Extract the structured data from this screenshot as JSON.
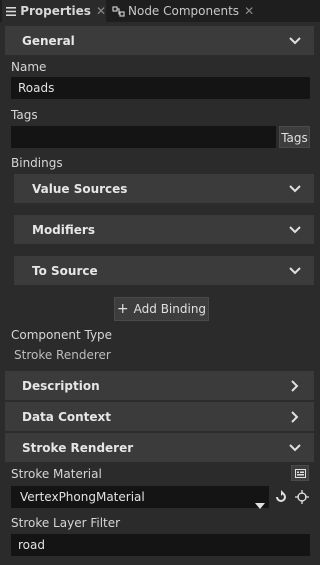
{
  "tabs": [
    {
      "label": "Properties",
      "icon": "properties-icon"
    },
    {
      "label": "Node Components",
      "icon": "node-components-icon"
    }
  ],
  "sections": {
    "general": "General",
    "value_sources": "Value Sources",
    "modifiers": "Modifiers",
    "to_source": "To Source",
    "description": "Description",
    "data_context": "Data Context",
    "stroke_renderer": "Stroke Renderer"
  },
  "fields": {
    "name_label": "Name",
    "name_value": "Roads",
    "tags_label": "Tags",
    "tags_value": "",
    "tags_button": "Tags",
    "bindings_label": "Bindings",
    "add_binding": "Add Binding",
    "component_type_label": "Component Type",
    "component_type_value": "Stroke Renderer",
    "stroke_material_label": "Stroke Material",
    "stroke_material_value": "VertexPhongMaterial",
    "stroke_layer_filter_label": "Stroke Layer Filter",
    "stroke_layer_filter_value": "road"
  },
  "colors": {
    "background": "#2b2b2b",
    "section": "#3b3b3b",
    "field": "#141414",
    "tabbar": "#1e1e1e"
  }
}
